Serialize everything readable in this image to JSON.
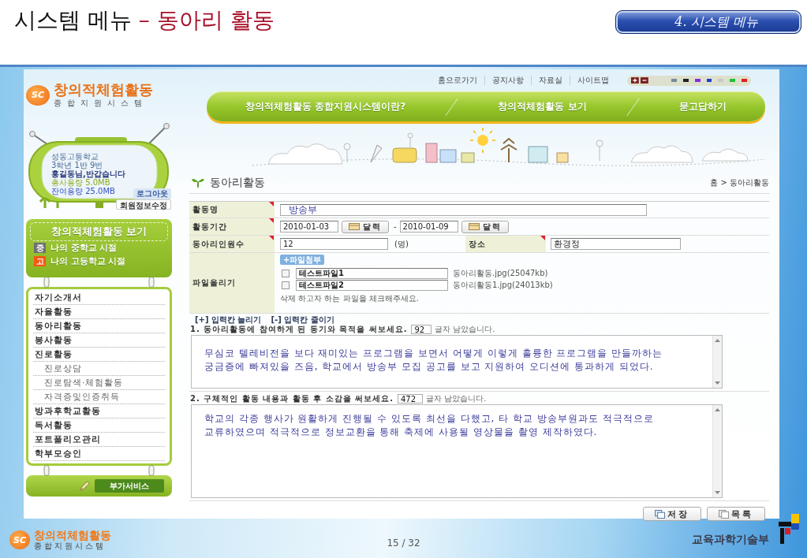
{
  "slide": {
    "title": "시스템 메뉴",
    "title_accent": "– 동아리 활동",
    "section_badge": "4. 시스템 메뉴",
    "page_number": "15 / 32",
    "footer_logo": {
      "mark": "SC",
      "title": "창의적체험활동",
      "subtitle": "종합지원시스템"
    },
    "ministry": "교육과학기술부"
  },
  "site": {
    "logo": {
      "mark": "SC",
      "title": "창의적체험활동",
      "subtitle": "종합지원시스템"
    },
    "util_links": [
      "홈으로가기",
      "공지사항",
      "자료실",
      "사이트맵"
    ],
    "swatches": [
      {
        "color": "#7a8a99"
      },
      {
        "color": "#222222"
      },
      {
        "color": "#8a2be2"
      },
      {
        "color": "#1f3fd0"
      },
      {
        "color": "#c8c8c8"
      },
      {
        "color": "#22c03a"
      },
      {
        "color": "#e02020"
      }
    ],
    "nav": [
      "창의적체험활동 종합지원시스템이란?",
      "창의적체험활동 보기",
      "묻고답하기"
    ]
  },
  "sidebar": {
    "user": {
      "school": "성동고등학교",
      "class": "3학년 1반 9번",
      "greeting": "홍길동님,반갑습니다",
      "used": "총사용량 5.0MB",
      "left": "잔여용량 25.0MB"
    },
    "logout": "로그아웃",
    "edit_profile": "회원정보수정",
    "panel": {
      "title": "창의적체험활동 보기",
      "items": [
        {
          "badge": "중",
          "label": "나의 중학교 시절",
          "color": "#707070"
        },
        {
          "badge": "고",
          "label": "나의 고등학교 시절",
          "color": "#f05a14"
        }
      ]
    },
    "menu": [
      {
        "label": "자기소개서"
      },
      {
        "label": "자율활동"
      },
      {
        "label": "동아리활동"
      },
      {
        "label": "봉사활동"
      },
      {
        "label": "진로활동",
        "children": [
          {
            "label": "진로상담"
          },
          {
            "label": "진로탐색·체험활동"
          },
          {
            "label": "자격증및인증취득"
          }
        ]
      },
      {
        "label": "방과후학교활동"
      },
      {
        "label": "독서활동"
      },
      {
        "label": "포트폴리오관리"
      },
      {
        "label": "학부모승인"
      }
    ],
    "service_button": "부가서비스"
  },
  "content": {
    "title": "동아리활동",
    "breadcrumb": "홈 > 동아리활동",
    "fields": [
      {
        "kind": "text",
        "label": "활동명",
        "required": true,
        "value": "방송부"
      },
      {
        "kind": "period",
        "label": "활동기간",
        "required": true,
        "start": "2010-01-03",
        "start_button": "달력",
        "separator": "-",
        "end": "2010-01-09",
        "end_button": "달력"
      },
      {
        "kind": "count",
        "label": "동아리인원수",
        "required": true,
        "value": "12",
        "unit": "(명)",
        "extra_label": "장소",
        "extra_required": true,
        "extra_value": "환경정"
      },
      {
        "kind": "files",
        "label": "파일올리기",
        "required": false,
        "button": "+파일첨부",
        "files": [
          {
            "checked": false,
            "name": "테스트파일1",
            "file": "동아리활동.jpg(25047kb)"
          },
          {
            "checked": false,
            "name": "테스트파일2",
            "file": "동아리활동1.jpg(24013kb)"
          }
        ],
        "hint": "삭제 하고자 하는 파일을 체크해주세요."
      }
    ],
    "resize_links": [
      "[+] 입력칸 늘리기",
      "[-] 입력칸 줄이기"
    ],
    "questions": [
      {
        "prompt": "1. 동아리활동에 참여하게 된 동기와 목적을 써보세요.",
        "remaining": "92",
        "remaining_label": "글자 남았습니다.",
        "answer": "무심코 텔레비전을 보다 재미있는 프로그램을 보면서 어떻게 이렇게 훌륭한 프로그램을 만들까하는 궁금증에 빠져있을 즈음, 학교에서 방송부 모집 공고를 보고 지원하여 오디션에 통과하게 되었다."
      },
      {
        "prompt": "2. 구체적인 활동 내용과 활동 후 소감을 써보세요.",
        "remaining": "472",
        "remaining_label": "글자 남았습니다.",
        "answer": "학교의 각종 행사가 원활하게 진행될 수 있도록 최선을 다했고, 타 학교 방송부원과도 적극적으로 교류하였으며 적극적으로 정보교환을 통해 축제에 사용될 영상물을 촬영 제작하였다."
      }
    ],
    "buttons": [
      {
        "kind": "save",
        "label": "저장"
      },
      {
        "kind": "list",
        "label": "목록"
      }
    ]
  }
}
